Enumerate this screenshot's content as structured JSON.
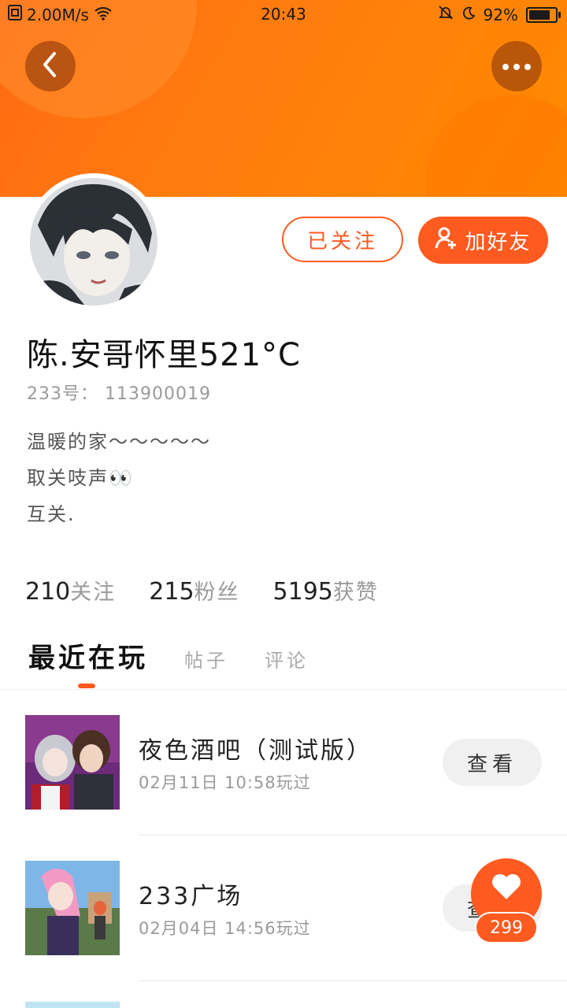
{
  "status_bar": {
    "net_speed": "2.00M/s",
    "time": "20:43",
    "battery": "92%",
    "battery_level": 0.92
  },
  "header": {
    "back_icon": "chevron-left-icon",
    "more_icon": "more-dots-icon"
  },
  "profile": {
    "name": "陈.安哥怀里521°C",
    "uid": "233号： 113900019",
    "bio_lines": [
      "温暖的家～～～～～",
      "取关吱声👀",
      "互关."
    ],
    "followed_label": "已关注",
    "add_friend_label": "加好友"
  },
  "stats": [
    {
      "num": "210",
      "label": "关注"
    },
    {
      "num": "215",
      "label": "粉丝"
    },
    {
      "num": "5195",
      "label": "获赞"
    }
  ],
  "tabs": [
    "最近在玩",
    "帖子",
    "评论"
  ],
  "games": [
    {
      "title": "夜色酒吧（测试版）",
      "time": "02月11日  10:58玩过",
      "button": "查看"
    },
    {
      "title": "233广场",
      "time": "02月04日  14:56玩过",
      "button": "查看"
    }
  ],
  "fab": {
    "icon": "heart-icon",
    "count": "299"
  },
  "colors": {
    "accent": "#ff5a1f",
    "banner": "#ff7d0e"
  }
}
